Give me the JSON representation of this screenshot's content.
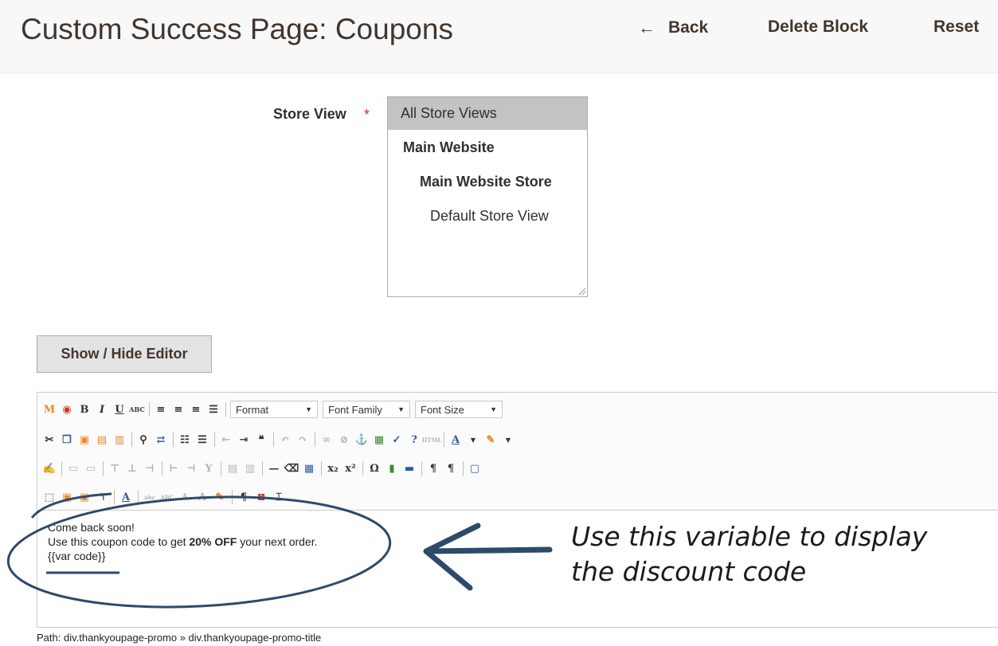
{
  "header": {
    "title": "Custom Success Page: Coupons",
    "back_label": "Back",
    "delete_label": "Delete Block",
    "reset_label": "Reset"
  },
  "store_view": {
    "label": "Store View",
    "required_mark": "*",
    "options": [
      "All Store Views",
      "Main Website",
      "Main Website Store",
      "Default Store View"
    ],
    "selected": "All Store Views"
  },
  "editor": {
    "toggle_label": "Show / Hide Editor",
    "format_label": "Format",
    "font_family_label": "Font Family",
    "font_size_label": "Font Size",
    "content": {
      "line1": "Come back soon!",
      "line2_pre": "Use this coupon code to get ",
      "line2_bold": "20% OFF",
      "line2_post": " your next order.",
      "line3": "{{var code}}"
    },
    "path": "Path: div.thankyoupage-promo » div.thankyoupage-promo-title"
  },
  "annotation": {
    "line1": "Use this variable to display",
    "line2": "the discount code",
    "color": "#2e4a6b"
  }
}
